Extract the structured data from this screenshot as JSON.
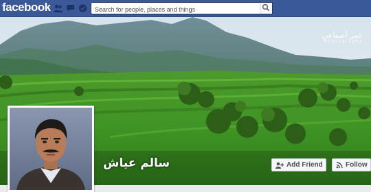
{
  "topbar": {
    "logo": "facebook",
    "search_placeholder": "Search for people, places and things",
    "jewels": [
      "friend-requests-icon",
      "messages-icon",
      "notifications-icon"
    ],
    "search_icon": "search-icon",
    "color": "#3b5998"
  },
  "cover": {
    "watermark_title": "عمر أصفاعي",
    "watermark_subtitle": "Photography"
  },
  "profile": {
    "name": "سالم عياش",
    "avatar": "avatar"
  },
  "actions": {
    "add_friend": "Add Friend",
    "follow": "Follow",
    "add_friend_icon": "add-friend-icon",
    "follow_icon": "rss-follow-icon"
  }
}
